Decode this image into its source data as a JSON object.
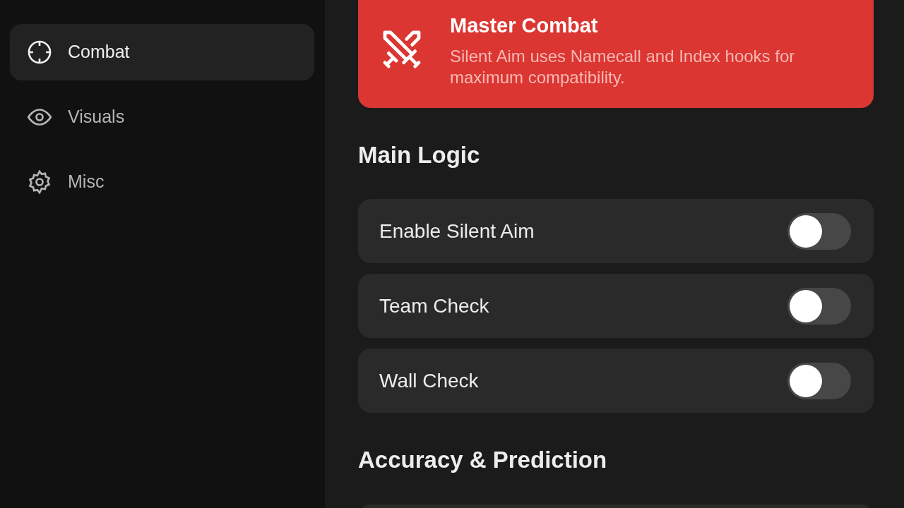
{
  "sidebar": {
    "items": [
      {
        "label": "Combat",
        "selected": true
      },
      {
        "label": "Visuals",
        "selected": false
      },
      {
        "label": "Misc",
        "selected": false
      }
    ]
  },
  "banner": {
    "title": "Master Combat",
    "text": "Silent Aim uses Namecall and Index hooks for maximum compatibility."
  },
  "sections": [
    {
      "title": "Main Logic",
      "settings": [
        {
          "kind": "toggle",
          "label": "Enable Silent Aim",
          "on": false
        },
        {
          "kind": "toggle",
          "label": "Team Check",
          "on": false
        },
        {
          "kind": "toggle",
          "label": "Wall Check",
          "on": false
        }
      ]
    },
    {
      "title": "Accuracy & Prediction",
      "settings": [
        {
          "kind": "blank"
        }
      ]
    }
  ]
}
